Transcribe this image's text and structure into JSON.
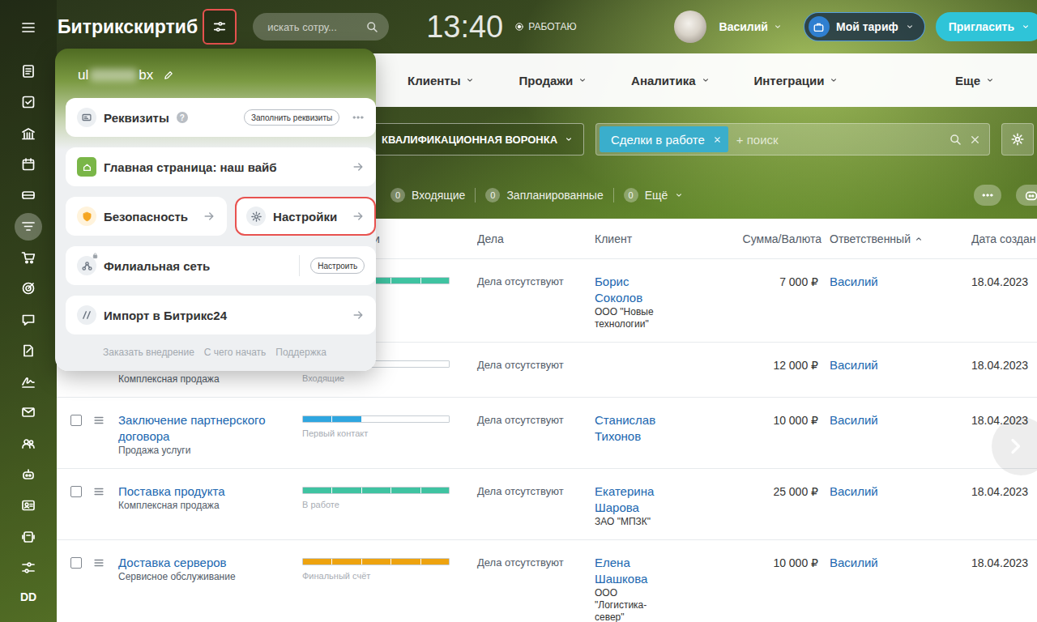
{
  "topbar": {
    "logo": "Битрикскиртиб",
    "settings_button": {
      "highlighted": true
    },
    "search": {
      "placeholder": "искать сотру..."
    },
    "clock": "13:40",
    "work_status": "РАБОТАЮ",
    "user": "Василий",
    "tariff_button": "Мой тариф",
    "invite_button": "Пригласить"
  },
  "sidebar": {
    "items": [
      {
        "kind": "menu",
        "selected": false
      },
      {
        "kind": "feed",
        "selected": false
      },
      {
        "kind": "tasks",
        "selected": false
      },
      {
        "kind": "company",
        "selected": false
      },
      {
        "kind": "calendar",
        "selected": false
      },
      {
        "kind": "drive",
        "selected": false
      },
      {
        "kind": "crm",
        "selected": true
      },
      {
        "kind": "shop",
        "selected": false
      },
      {
        "kind": "marketing",
        "selected": false
      },
      {
        "kind": "chat",
        "selected": false
      },
      {
        "kind": "docs",
        "selected": false
      },
      {
        "kind": "sign",
        "selected": false
      },
      {
        "kind": "mail",
        "selected": false
      },
      {
        "kind": "team",
        "selected": false
      },
      {
        "kind": "robot",
        "selected": false
      },
      {
        "kind": "contacts",
        "selected": false
      },
      {
        "kind": "market",
        "selected": false
      },
      {
        "kind": "settings",
        "selected": false
      }
    ],
    "footer": "DD"
  },
  "nav": {
    "items": [
      {
        "label": "Клиенты"
      },
      {
        "label": "Продажи"
      },
      {
        "label": "Аналитика"
      },
      {
        "label": "Интеграции"
      }
    ],
    "more": "Еще"
  },
  "filter": {
    "pipeline": "КВАЛИФИКАЦИОННАЯ ВОРОНКА",
    "preset": "Сделки в работе",
    "search_placeholder": "+ поиск"
  },
  "counters": [
    {
      "count": "0",
      "label": "Входящие",
      "dropdown": false
    },
    {
      "count": "0",
      "label": "Запланированные",
      "dropdown": false
    },
    {
      "count": "0",
      "label": "Ещё",
      "dropdown": true
    }
  ],
  "table": {
    "columns": [
      {
        "label": "и",
        "sorted": false
      },
      {
        "label": "Дела",
        "sorted": false
      },
      {
        "label": "Клиент",
        "sorted": false
      },
      {
        "label": "Сумма/Валюта",
        "sorted": false
      },
      {
        "label": "Ответственный",
        "sorted": true
      },
      {
        "label": "Дата создан",
        "sorted": false
      }
    ],
    "rows": [
      {
        "level": 1,
        "color": "#3fc3a1",
        "activities": "Дела отсутствуют",
        "client": "Борис Соколов",
        "company": "ООО \"Новые технологии\"",
        "amount": "7 000 ₽",
        "responsible": "Василий",
        "date": "18.04.2023"
      },
      {
        "subtitle": "Комплексная продажа",
        "stage": "Входящие",
        "level": 0.2,
        "color": "#39a8ef",
        "activities": "Дела отсутствуют",
        "amount": "12 000 ₽",
        "responsible": "Василий",
        "date": "18.04.2023"
      },
      {
        "title": "Заключение партнерского договора",
        "subtitle": "Продажа услуги",
        "stage": "Первый контакт",
        "level": 0.4,
        "color": "#2fa6e0",
        "activities": "Дела отсутствуют",
        "client": "Станислав Тихонов",
        "amount": "10 000 ₽",
        "responsible": "Василий",
        "date": "18.04.2023"
      },
      {
        "title": "Поставка продукта",
        "subtitle": "Комплексная продажа",
        "stage": "В работе",
        "level": 1,
        "color": "#3fc3a1",
        "activities": "Дела отсутствуют",
        "client": "Екатерина Шарова",
        "company": "ЗАО \"МПЗК\"",
        "amount": "25 000 ₽",
        "responsible": "Василий",
        "date": "18.04.2023"
      },
      {
        "title": "Доставка серверов",
        "subtitle": "Сервисное обслуживание",
        "stage": "Финальный счёт",
        "level": 1,
        "color": "#eea30f",
        "activities": "Дела отсутствуют",
        "client": "Елена Шашкова",
        "company": "ООО \"Логистика-север\"",
        "amount": "10 000 ₽",
        "responsible": "Василий",
        "date": "18.04.2023"
      }
    ]
  },
  "portal_menu": {
    "name_start": "ul",
    "name_end": "bx",
    "cards": [
      {
        "kind": "requisites",
        "label": "Реквизиты",
        "help": "?",
        "button": "Заполнить реквизиты",
        "highlighted": false
      },
      {
        "kind": "home",
        "label": "Главная страница: наш вайб",
        "highlighted": false
      },
      {
        "kind": "security",
        "label": "Безопасность",
        "highlighted": false
      },
      {
        "kind": "settings",
        "label": "Настройки",
        "highlighted": true
      },
      {
        "kind": "branch",
        "label": "Филиальная сеть",
        "button": "Настроить",
        "highlighted": false
      },
      {
        "kind": "import",
        "label": "Импорт в Битрикс24",
        "highlighted": false
      }
    ],
    "footer_links": [
      "Заказать внедрение",
      "С чего начать",
      "Поддержка"
    ]
  }
}
